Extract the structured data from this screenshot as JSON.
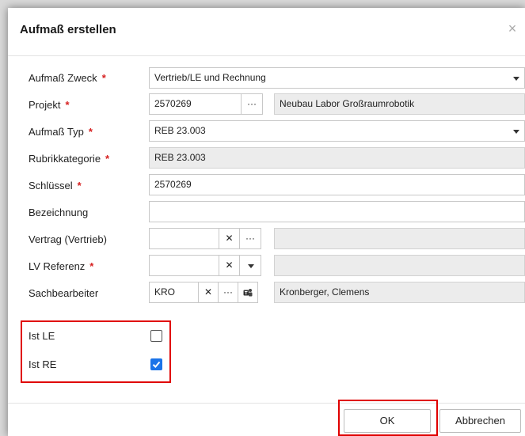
{
  "dialog": {
    "title": "Aufmaß erstellen",
    "close_glyph": "×"
  },
  "required_marker": "*",
  "fields": {
    "zweck": {
      "label": "Aufmaß Zweck",
      "value": "Vertrieb/LE und Rechnung"
    },
    "projekt": {
      "label": "Projekt",
      "value": "2570269",
      "name": "Neubau Labor Großraumrobotik"
    },
    "typ": {
      "label": "Aufmaß Typ",
      "value": "REB 23.003"
    },
    "rubrik": {
      "label": "Rubrikkategorie",
      "value": "REB 23.003"
    },
    "schluessel": {
      "label": "Schlüssel",
      "value": "2570269"
    },
    "bezeichnung": {
      "label": "Bezeichnung",
      "value": ""
    },
    "vertrag": {
      "label": "Vertrag (Vertrieb)",
      "value": "",
      "name": ""
    },
    "lv": {
      "label": "LV Referenz",
      "value": "",
      "name": ""
    },
    "sachbearbeiter": {
      "label": "Sachbearbeiter",
      "value": "KRO",
      "name": "Kronberger, Clemens"
    }
  },
  "checks": {
    "ist_le": {
      "label": "Ist LE",
      "checked": false
    },
    "ist_re": {
      "label": "Ist RE",
      "checked": true
    }
  },
  "glyphs": {
    "clear": "✕",
    "more": "···"
  },
  "buttons": {
    "ok": "OK",
    "cancel": "Abbrechen"
  },
  "colors": {
    "required": "#d62020",
    "checkbox_checked": "#1a73e8",
    "highlight": "#e00000"
  }
}
